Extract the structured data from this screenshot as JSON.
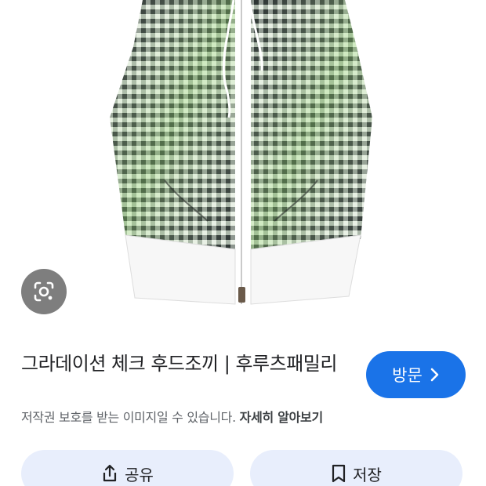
{
  "result": {
    "title": "그라데이션 체크 후드조끼 | 후루츠패밀리",
    "visit_label": "방문",
    "notice_text": "저작권 보호를 받는 이미지일 수 있습니다.",
    "learn_more_label": "자세히 알아보기"
  },
  "actions": {
    "share_label": "공유",
    "save_label": "저장"
  },
  "icons": {
    "lens": "google-lens-icon",
    "visit_arrow": "chevron-right-icon",
    "share": "share-icon",
    "save": "bookmark-icon"
  },
  "colors": {
    "accent": "#1a73e8",
    "action_bg": "#e8eefc",
    "notice": "#5f6368"
  }
}
